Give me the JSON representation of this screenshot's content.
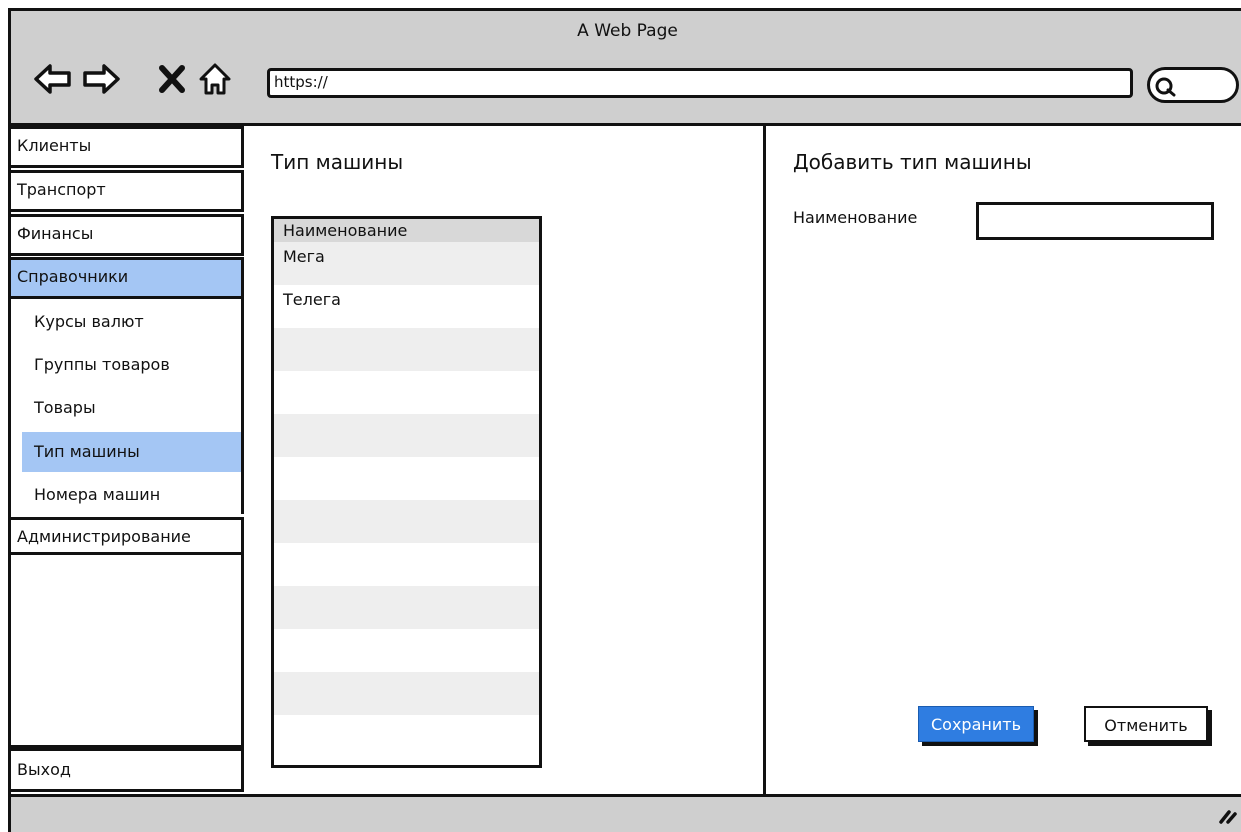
{
  "browser": {
    "title": "A Web Page",
    "url": "https://"
  },
  "sidebar": {
    "top_items": [
      {
        "label": "Клиенты"
      },
      {
        "label": "Транспорт"
      },
      {
        "label": "Финансы"
      },
      {
        "label": "Справочники",
        "active": true
      }
    ],
    "sub_items": [
      {
        "label": "Курсы валют"
      },
      {
        "label": "Группы товаров"
      },
      {
        "label": "Товары"
      },
      {
        "label": "Тип машины",
        "active": true
      },
      {
        "label": "Номера машин"
      }
    ],
    "admin": {
      "label": "Администрирование"
    },
    "logout": {
      "label": "Выход"
    }
  },
  "list": {
    "title": "Тип машины",
    "column_header": "Наименование",
    "rows": [
      "Мега",
      "Телега"
    ]
  },
  "form": {
    "title": "Добавить тип машины",
    "name_label": "Наименование",
    "name_value": "",
    "save_label": "Сохранить",
    "cancel_label": "Отменить"
  },
  "colors": {
    "chrome": "#cfcfcf",
    "active_menu": "#a4c6f4",
    "primary_button": "#2f7de1"
  },
  "icons": [
    "back-arrow-icon",
    "forward-arrow-icon",
    "close-icon",
    "home-icon",
    "search-icon",
    "resize-grip-icon"
  ]
}
